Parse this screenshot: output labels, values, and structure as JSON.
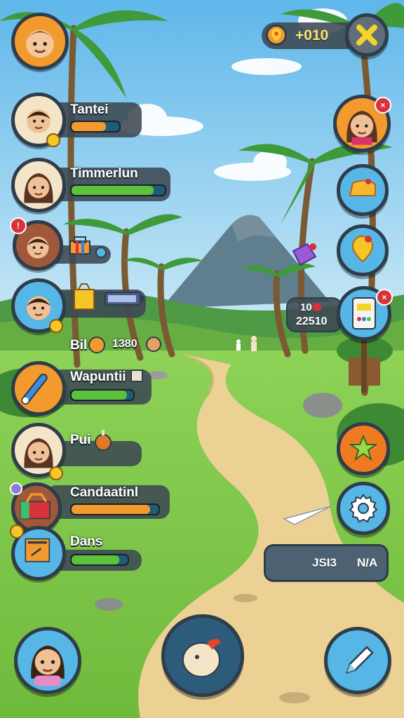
{
  "top_bar": {
    "coin_value": "+010"
  },
  "characters": [
    {
      "name": "Tantei",
      "progress": 0.72,
      "fill_color": "#f39a2e"
    },
    {
      "name": "Timmerlun",
      "progress": 0.88,
      "fill_color": "#5cc23c"
    },
    {
      "name": "",
      "progress": null,
      "fill_color": ""
    },
    {
      "name": "",
      "progress": null,
      "fill_color": ""
    },
    {
      "name": "Wapuntii",
      "progress": 0.9,
      "fill_color": "#5cc23c"
    },
    {
      "name": "Pui",
      "progress": null,
      "fill_color": ""
    },
    {
      "name": "Candaatinl",
      "progress": 0.9,
      "fill_color": "#f39a2e"
    },
    {
      "name": "Dans",
      "progress": 0.85,
      "fill_color": "#5cc23c"
    }
  ],
  "item_row": {
    "label": "Bil",
    "value": "1380"
  },
  "score_box": {
    "top": "10",
    "bottom": "22510"
  },
  "bottom_panel": {
    "left_text": "JSI3",
    "right_text": "N/A"
  },
  "colors": {
    "panel": "#3c4852",
    "accent_orange": "#f39a2e",
    "accent_green": "#5cc23c",
    "accent_blue": "#56b6e6",
    "close_yellow": "#f6d32a"
  },
  "icons": [
    "coin-icon",
    "close-icon",
    "star-icon",
    "gear-icon",
    "pencil-icon",
    "map-pin-icon",
    "cheese-icon",
    "bell-icon",
    "card-icon",
    "chicken-icon",
    "microphone-icon",
    "toolbox-icon",
    "package-icon"
  ]
}
